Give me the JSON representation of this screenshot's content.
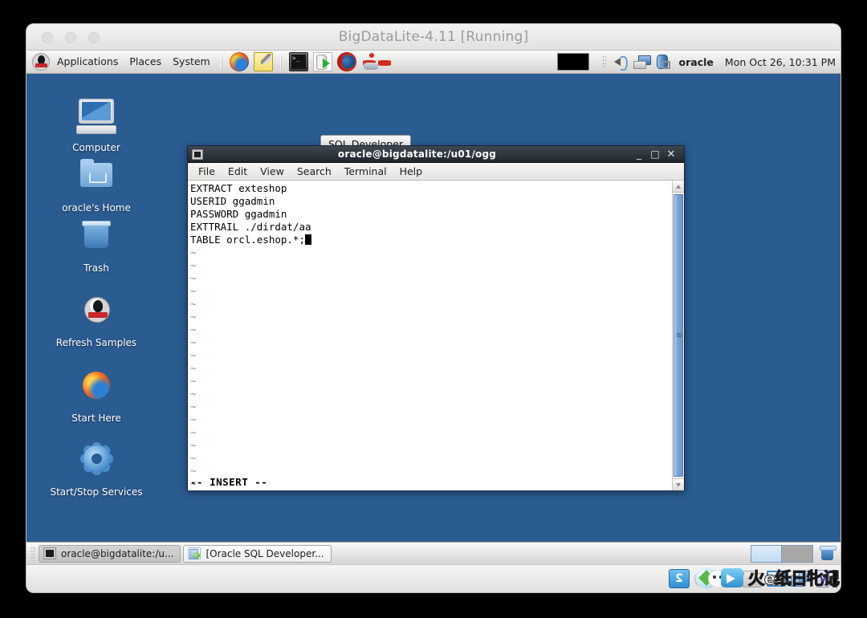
{
  "vbox": {
    "window_title": "BigDataLite-4.11 [Running]",
    "controls": [
      "close",
      "minimize",
      "zoom"
    ],
    "statusbar_icons": [
      "hard-disk-icon",
      "optical-disk-icon",
      "network-icon",
      "shared-folder-icon",
      "display-icon",
      "usb-icon",
      "virtualization-icon",
      "host-key-icon"
    ],
    "watermark_text": "火e纸日牝记"
  },
  "top_panel": {
    "logo_icon": "oracle-linux-penguin-icon",
    "menus": [
      "Applications",
      "Places",
      "System"
    ],
    "launchers": [
      {
        "name": "firefox-launcher",
        "icon": "firefox-icon"
      },
      {
        "name": "text-editor-launcher",
        "icon": "gedit-icon"
      },
      {
        "name": "terminal-launcher",
        "icon": "terminal-icon"
      },
      {
        "name": "sql-developer-launcher",
        "icon": "sql-developer-icon"
      },
      {
        "name": "oracle-launcher",
        "icon": "oracle-circle-icon"
      },
      {
        "name": "database-tools-launcher",
        "icon": "molecule-database-icon"
      }
    ],
    "terminal_glyph": ">_",
    "tray": [
      "volume-icon",
      "network-icon",
      "power-icon"
    ],
    "user": "oracle",
    "clock": "Mon Oct 26, 10:31 PM"
  },
  "tooltip": {
    "text": "SQL Developer"
  },
  "desktop_icons": [
    {
      "label": "Computer",
      "icon": "computer-icon"
    },
    {
      "label": "oracle's Home",
      "icon": "home-folder-icon"
    },
    {
      "label": "Trash",
      "icon": "trash-icon"
    },
    {
      "label": "Refresh Samples",
      "icon": "penguin-script-icon"
    },
    {
      "label": "Start Here",
      "icon": "firefox-icon"
    },
    {
      "label": "Start/Stop Services",
      "icon": "gear-icon"
    }
  ],
  "terminal": {
    "title": "oracle@bigdatalite:/u01/ogg",
    "title_icon": "terminal-icon",
    "buttons": {
      "minimize": "_",
      "maximize": "□",
      "close": "✕"
    },
    "menus": [
      "File",
      "Edit",
      "View",
      "Search",
      "Terminal",
      "Help"
    ],
    "lines": [
      "EXTRACT exteshop",
      "USERID ggadmin",
      "PASSWORD ggadmin",
      "EXTTRAIL ./dirdat/aa",
      "TABLE orcl.eshop.*;"
    ],
    "empty_marker": "~",
    "empty_marker_count": 19,
    "status": "-- INSERT --",
    "cursor_visible": true
  },
  "bottom_panel": {
    "tasks": [
      {
        "label": "oracle@bigdatalite:/u...",
        "icon": "terminal-icon",
        "active": true
      },
      {
        "label": "[Oracle SQL Developer...",
        "icon": "sql-developer-icon",
        "active": false
      }
    ],
    "workspaces": [
      {
        "active": true
      },
      {
        "active": false
      }
    ],
    "trash_applet_icon": "trash-icon"
  },
  "colors": {
    "desktop_blue": "#2b5c91",
    "panel_gray": "#e6e4e2",
    "titlebar_dark": "#2b333c",
    "terminal_bg": "#ffffff",
    "tilde_blue": "#6f8fc4",
    "scrollbar_blue": "#7ea5d4"
  }
}
